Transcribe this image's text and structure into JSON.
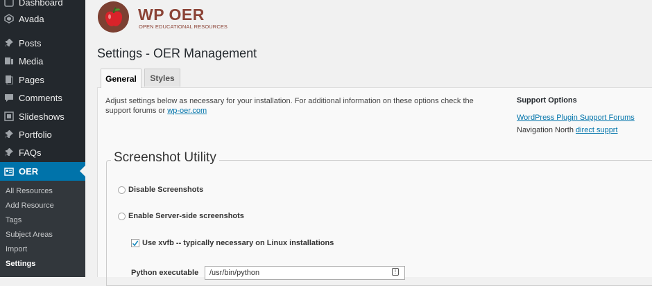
{
  "sidebar": {
    "items": [
      {
        "label": "Dashboard",
        "icon": "dashboard-icon"
      },
      {
        "label": "Avada",
        "icon": "avada-icon"
      },
      {
        "label": "Posts",
        "icon": "pin-icon"
      },
      {
        "label": "Media",
        "icon": "media-icon"
      },
      {
        "label": "Pages",
        "icon": "pages-icon"
      },
      {
        "label": "Comments",
        "icon": "comment-icon"
      },
      {
        "label": "Slideshows",
        "icon": "slideshow-icon"
      },
      {
        "label": "Portfolio",
        "icon": "pin-icon"
      },
      {
        "label": "FAQs",
        "icon": "pin-icon"
      },
      {
        "label": "OER",
        "icon": "oer-icon"
      }
    ],
    "submenu": [
      {
        "label": "All Resources"
      },
      {
        "label": "Add Resource"
      },
      {
        "label": "Tags"
      },
      {
        "label": "Subject Areas"
      },
      {
        "label": "Import"
      },
      {
        "label": "Settings"
      }
    ],
    "active_color": "#0073aa"
  },
  "logo": {
    "title": "WP OER",
    "subtitle": "OPEN EDUCATIONAL RESOURCES",
    "icon": "apple-icon"
  },
  "page_title": "Settings - OER Management",
  "tabs": [
    {
      "label": "General"
    },
    {
      "label": "Styles"
    }
  ],
  "intro": {
    "text": "Adjust settings below as necessary for your installation. For additional information on these options check the support forums or ",
    "link": "wp-oer.com"
  },
  "support": {
    "heading": "Support Options",
    "forum_link": "WordPress Plugin Support Forums",
    "nav_text": "Navigation North ",
    "nav_link": "direct supprt"
  },
  "screenshot_utility": {
    "legend": "Screenshot Utility",
    "options": [
      {
        "label": "Disable Screenshots",
        "selected": false
      },
      {
        "label": "Enable Server-side screenshots",
        "selected": false
      }
    ],
    "xvfb_label": "Use xvfb -- typically necessary on Linux installations",
    "xvfb_checked": true,
    "python_label": "Python executable",
    "python_value": "/usr/bin/python"
  }
}
